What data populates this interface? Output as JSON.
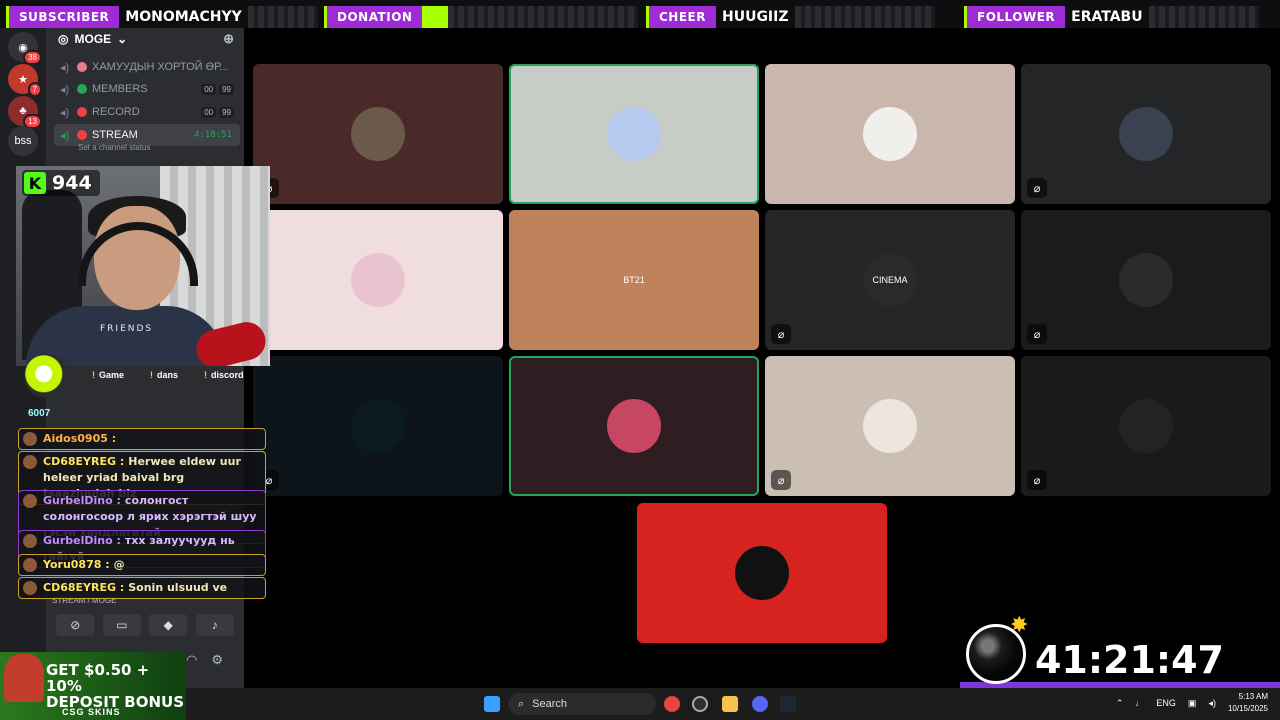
{
  "alerts": [
    {
      "tag": "SUBSCRIBER",
      "name": "MONOMACHYY"
    },
    {
      "tag": "DONATION",
      "name": ""
    },
    {
      "tag": "CHEER",
      "name": "HUUGIIZ"
    },
    {
      "tag": "FOLLOWER",
      "name": "ERATABU"
    }
  ],
  "rail": {
    "badges": [
      "38",
      "7",
      "13"
    ],
    "bss_label": "bss"
  },
  "server": {
    "name": "MOGE",
    "channels": [
      {
        "label": "ХАМУУДЫН ХОРТОЙ ӨР...",
        "counts": []
      },
      {
        "label": "MEMBERS",
        "counts": [
          "00",
          "99"
        ],
        "dot_color": "#23a55a"
      },
      {
        "label": "RECORD",
        "counts": [
          "00",
          "99"
        ],
        "dot_color": "#f23f43"
      },
      {
        "label": "STREAM",
        "timer": "4:18:51",
        "dot_color": "#f23f43"
      }
    ],
    "channel_status_placeholder": "Set a channel status",
    "voice_footer": "STREAM / MOGE"
  },
  "stream": {
    "kick_count": "944",
    "commands": [
      "Game",
      "dans",
      "discord"
    ],
    "sub_count": "6007",
    "webcam_shirt_text": "FRIENDS"
  },
  "chat": [
    {
      "user": "Aidos0905 :",
      "text": "",
      "style": "red"
    },
    {
      "user": "CD68EYREG :",
      "text": "Herwee eldew uur heleer yriad baival brg tsaazluulah biz",
      "style": "gold"
    },
    {
      "user": "GurbelDino :",
      "text": "солонгост солонгосоор л ярих хэрэгтэй шуу гэсэн хандлагатай",
      "style": "purple"
    },
    {
      "user": "GurbelDino :",
      "text": "тхх залуучууд нь гайгүй",
      "style": "purple"
    },
    {
      "user": "Yoru0878 :",
      "text": "@",
      "style": "gold"
    },
    {
      "user": "CD68EYREG :",
      "text": "Sonin ulsuud ve",
      "style": "gold"
    }
  ],
  "tiles": [
    {
      "bg": "#4a2a28",
      "avatar_bg": "#6b5a4a",
      "muted": true,
      "speaking": false,
      "caption": ""
    },
    {
      "bg": "#c7ccc7",
      "avatar_bg": "#b6c9ee",
      "muted": false,
      "speaking": true,
      "caption": ""
    },
    {
      "bg": "#c9b7ae",
      "avatar_bg": "#f1efec",
      "muted": false,
      "speaking": false,
      "caption": ""
    },
    {
      "bg": "#232527",
      "avatar_bg": "#3a4150",
      "muted": true,
      "speaking": false,
      "caption": ""
    },
    {
      "bg": "#f0dde0",
      "avatar_bg": "#e9c3cf",
      "muted": false,
      "speaking": false,
      "caption": ""
    },
    {
      "bg": "#c0825a",
      "avatar_bg": "#c0825a",
      "muted": false,
      "speaking": false,
      "caption": "BT21"
    },
    {
      "bg": "#232527",
      "avatar_bg": "#2a2a2a",
      "muted": true,
      "speaking": false,
      "caption": "CINEMA"
    },
    {
      "bg": "#1c1b19",
      "avatar_bg": "#2b2b2b",
      "muted": true,
      "speaking": false,
      "caption": ""
    },
    {
      "bg": "#0d151a",
      "avatar_bg": "#0c1b20",
      "muted": true,
      "speaking": false,
      "caption": ""
    },
    {
      "bg": "#2e1e22",
      "avatar_bg": "#c74664",
      "muted": false,
      "speaking": true,
      "caption": ""
    },
    {
      "bg": "#cbbfb3",
      "avatar_bg": "#ece6df",
      "muted": true,
      "speaking": false,
      "caption": ""
    },
    {
      "bg": "#1a1a1a",
      "avatar_bg": "#232323",
      "muted": true,
      "speaking": false,
      "caption": ""
    },
    {
      "bg": "#d6231f",
      "avatar_bg": "#111111",
      "muted": false,
      "speaking": false,
      "caption": ""
    }
  ],
  "countdown": "41:21:47",
  "ad": {
    "line1": "GET $0.50 + 10%",
    "line2": "DEPOSIT BONUS",
    "brand": "CSG SKINS"
  },
  "taskbar": {
    "search_label": "Search",
    "lang": "ENG",
    "time": "5:13 AM",
    "date": "10/15/2025"
  }
}
